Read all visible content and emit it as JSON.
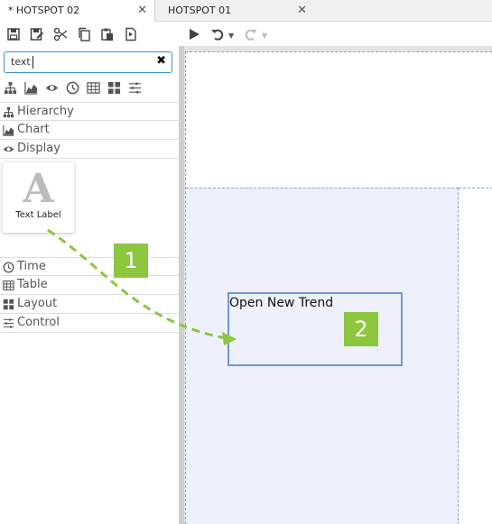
{
  "tabs": [
    {
      "label": "* HOTSPOT 02",
      "close": "✕",
      "active": true
    },
    {
      "label": "HOTSPOT 01",
      "close": "✕",
      "active": false
    }
  ],
  "toolbar": {
    "icons": [
      "save-icon",
      "save-as-icon",
      "cut-icon",
      "copy-icon",
      "paste-icon",
      "export-icon",
      "run-icon",
      "undo-icon",
      "redo-icon"
    ]
  },
  "search": {
    "value": "text",
    "clear": "✖"
  },
  "category_icons": [
    "hierarchy-icon",
    "chart-icon",
    "display-icon",
    "time-icon",
    "table-icon",
    "layout-icon",
    "control-icon"
  ],
  "categories_top": [
    {
      "label": "Hierarchy",
      "icon": "hierarchy-icon"
    },
    {
      "label": "Chart",
      "icon": "chart-icon"
    },
    {
      "label": "Display",
      "icon": "display-icon"
    }
  ],
  "widget": {
    "glyph": "A",
    "label": "Text Label"
  },
  "categories_bottom": [
    {
      "label": "Time",
      "icon": "time-icon"
    },
    {
      "label": "Table",
      "icon": "table-icon"
    },
    {
      "label": "Layout",
      "icon": "layout-icon"
    },
    {
      "label": "Control",
      "icon": "control-icon"
    }
  ],
  "canvas": {
    "dropped_label_text": "Open New Trend"
  },
  "callouts": [
    "1",
    "2"
  ],
  "colors": {
    "accent": "#8dc63f",
    "selection": "#6f98d4",
    "search_border": "#3c93d1",
    "hotspot_fill": "#eef1fb"
  }
}
